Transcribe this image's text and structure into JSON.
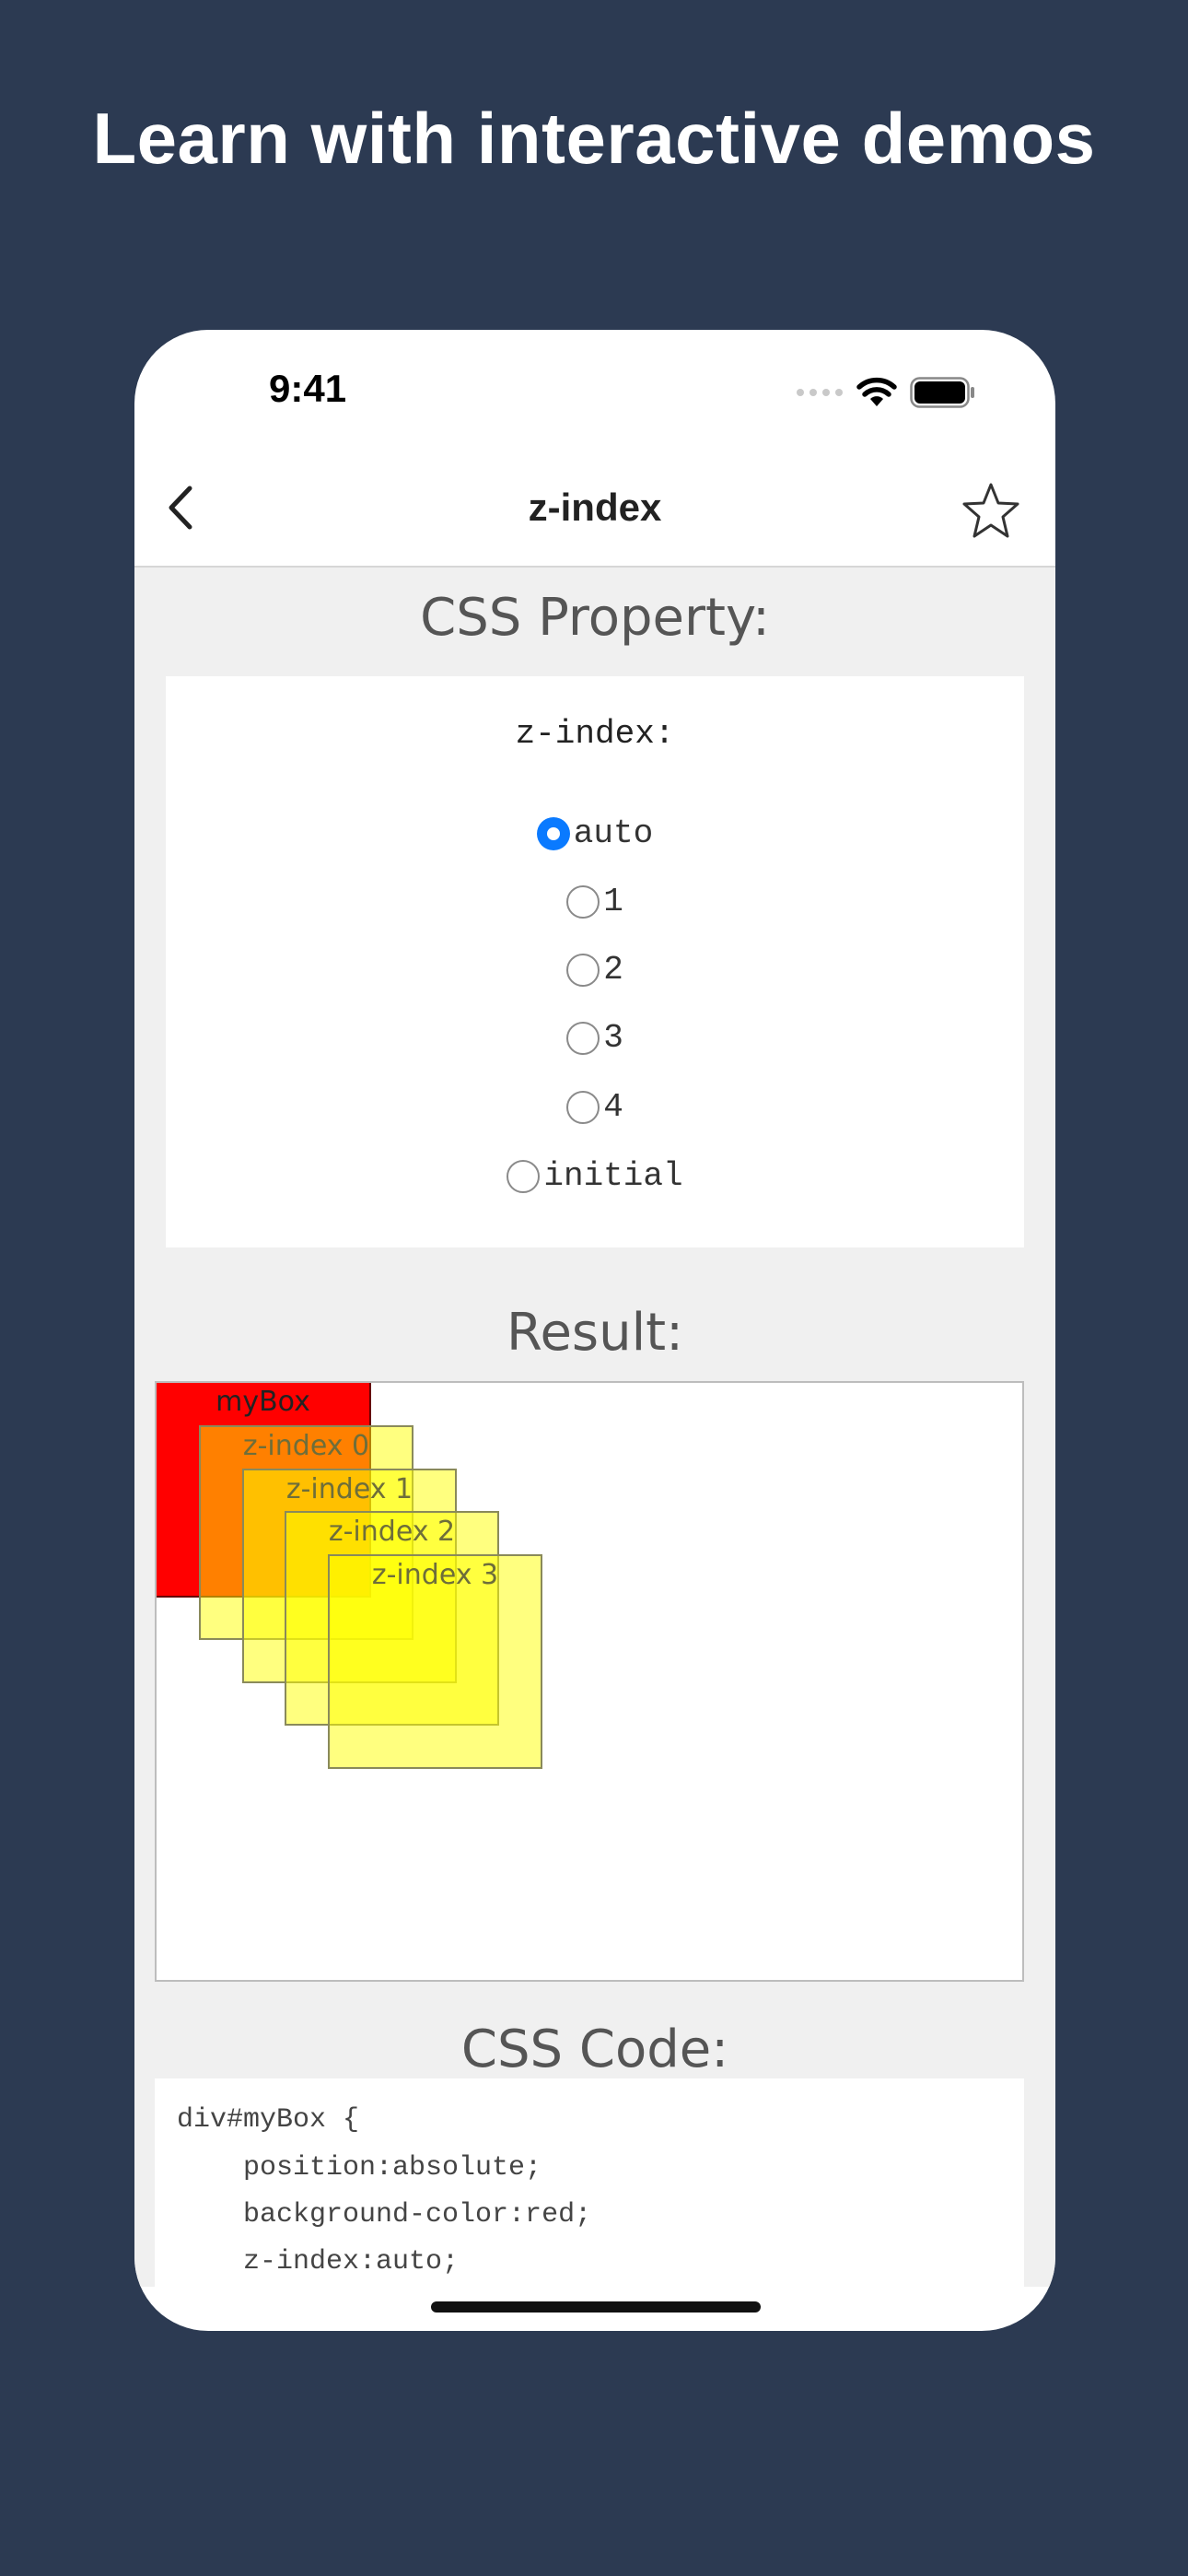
{
  "headline": "Learn with interactive demos",
  "status_bar": {
    "time": "9:41",
    "icons": [
      "signal-dots-icon",
      "wifi-icon",
      "battery-icon"
    ]
  },
  "nav": {
    "back_icon": "chevron-left-icon",
    "title": "z-index",
    "favorite_icon": "star-outline-icon"
  },
  "property_section": {
    "title": "CSS Property:",
    "property_label": "z-index:",
    "options": [
      {
        "label": "auto",
        "checked": true
      },
      {
        "label": "1",
        "checked": false
      },
      {
        "label": "2",
        "checked": false
      },
      {
        "label": "3",
        "checked": false
      },
      {
        "label": "4",
        "checked": false
      },
      {
        "label": "initial",
        "checked": false
      }
    ]
  },
  "result_section": {
    "title": "Result:",
    "mybox_label": "myBox",
    "layer_labels": [
      "z-index 0",
      "z-index 1",
      "z-index 2",
      "z-index 3"
    ]
  },
  "code_section": {
    "title": "CSS Code:",
    "lines": [
      "div#myBox {",
      "    position:absolute;",
      "    background-color:red;",
      "    z-index:auto;"
    ]
  },
  "colors": {
    "background": "#2c3a52",
    "accent": "#0a7aff",
    "mybox": "#ff0000",
    "layer": "#ffff00"
  }
}
